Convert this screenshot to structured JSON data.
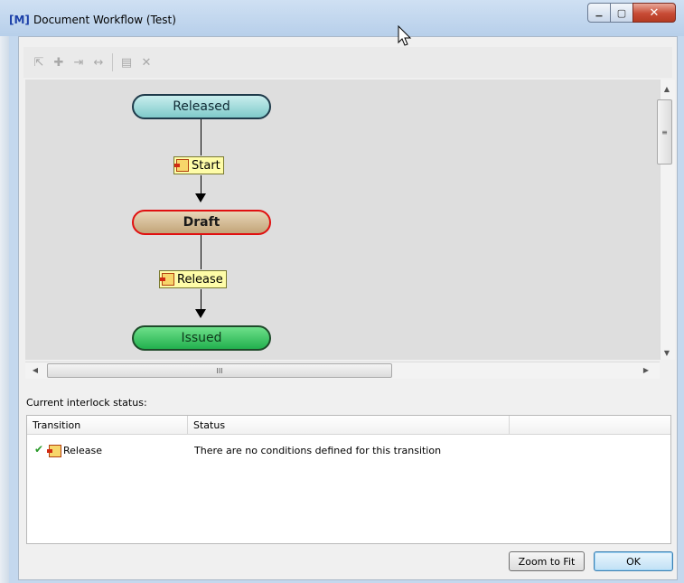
{
  "window": {
    "logo": "[M]",
    "title": "Document Workflow (Test)",
    "min_glyph": "▁",
    "max_glyph": "▢",
    "close_glyph": "✕"
  },
  "toolbar": {
    "icons": [
      "pointer-icon",
      "add-state-icon",
      "add-transition-icon",
      "link-icon",
      "properties-icon",
      "delete-icon"
    ],
    "glyphs": [
      "⇱",
      "✚",
      "⇥",
      "↔",
      "▤",
      "✕"
    ]
  },
  "diagram": {
    "states": [
      {
        "label": "Released"
      },
      {
        "label": "Draft"
      },
      {
        "label": "Issued"
      }
    ],
    "transitions": [
      {
        "label": "Start"
      },
      {
        "label": "Release"
      }
    ],
    "hscroll_glyph": "III",
    "vscroll_glyph": "≡"
  },
  "interlock": {
    "label": "Current interlock status:",
    "columns": [
      "Transition",
      "Status"
    ],
    "rows": [
      {
        "check": "✔",
        "transition": "Release",
        "status": "There are no conditions defined for this transition"
      }
    ]
  },
  "buttons": {
    "zoom_to_fit": "Zoom to Fit",
    "ok": "OK"
  }
}
